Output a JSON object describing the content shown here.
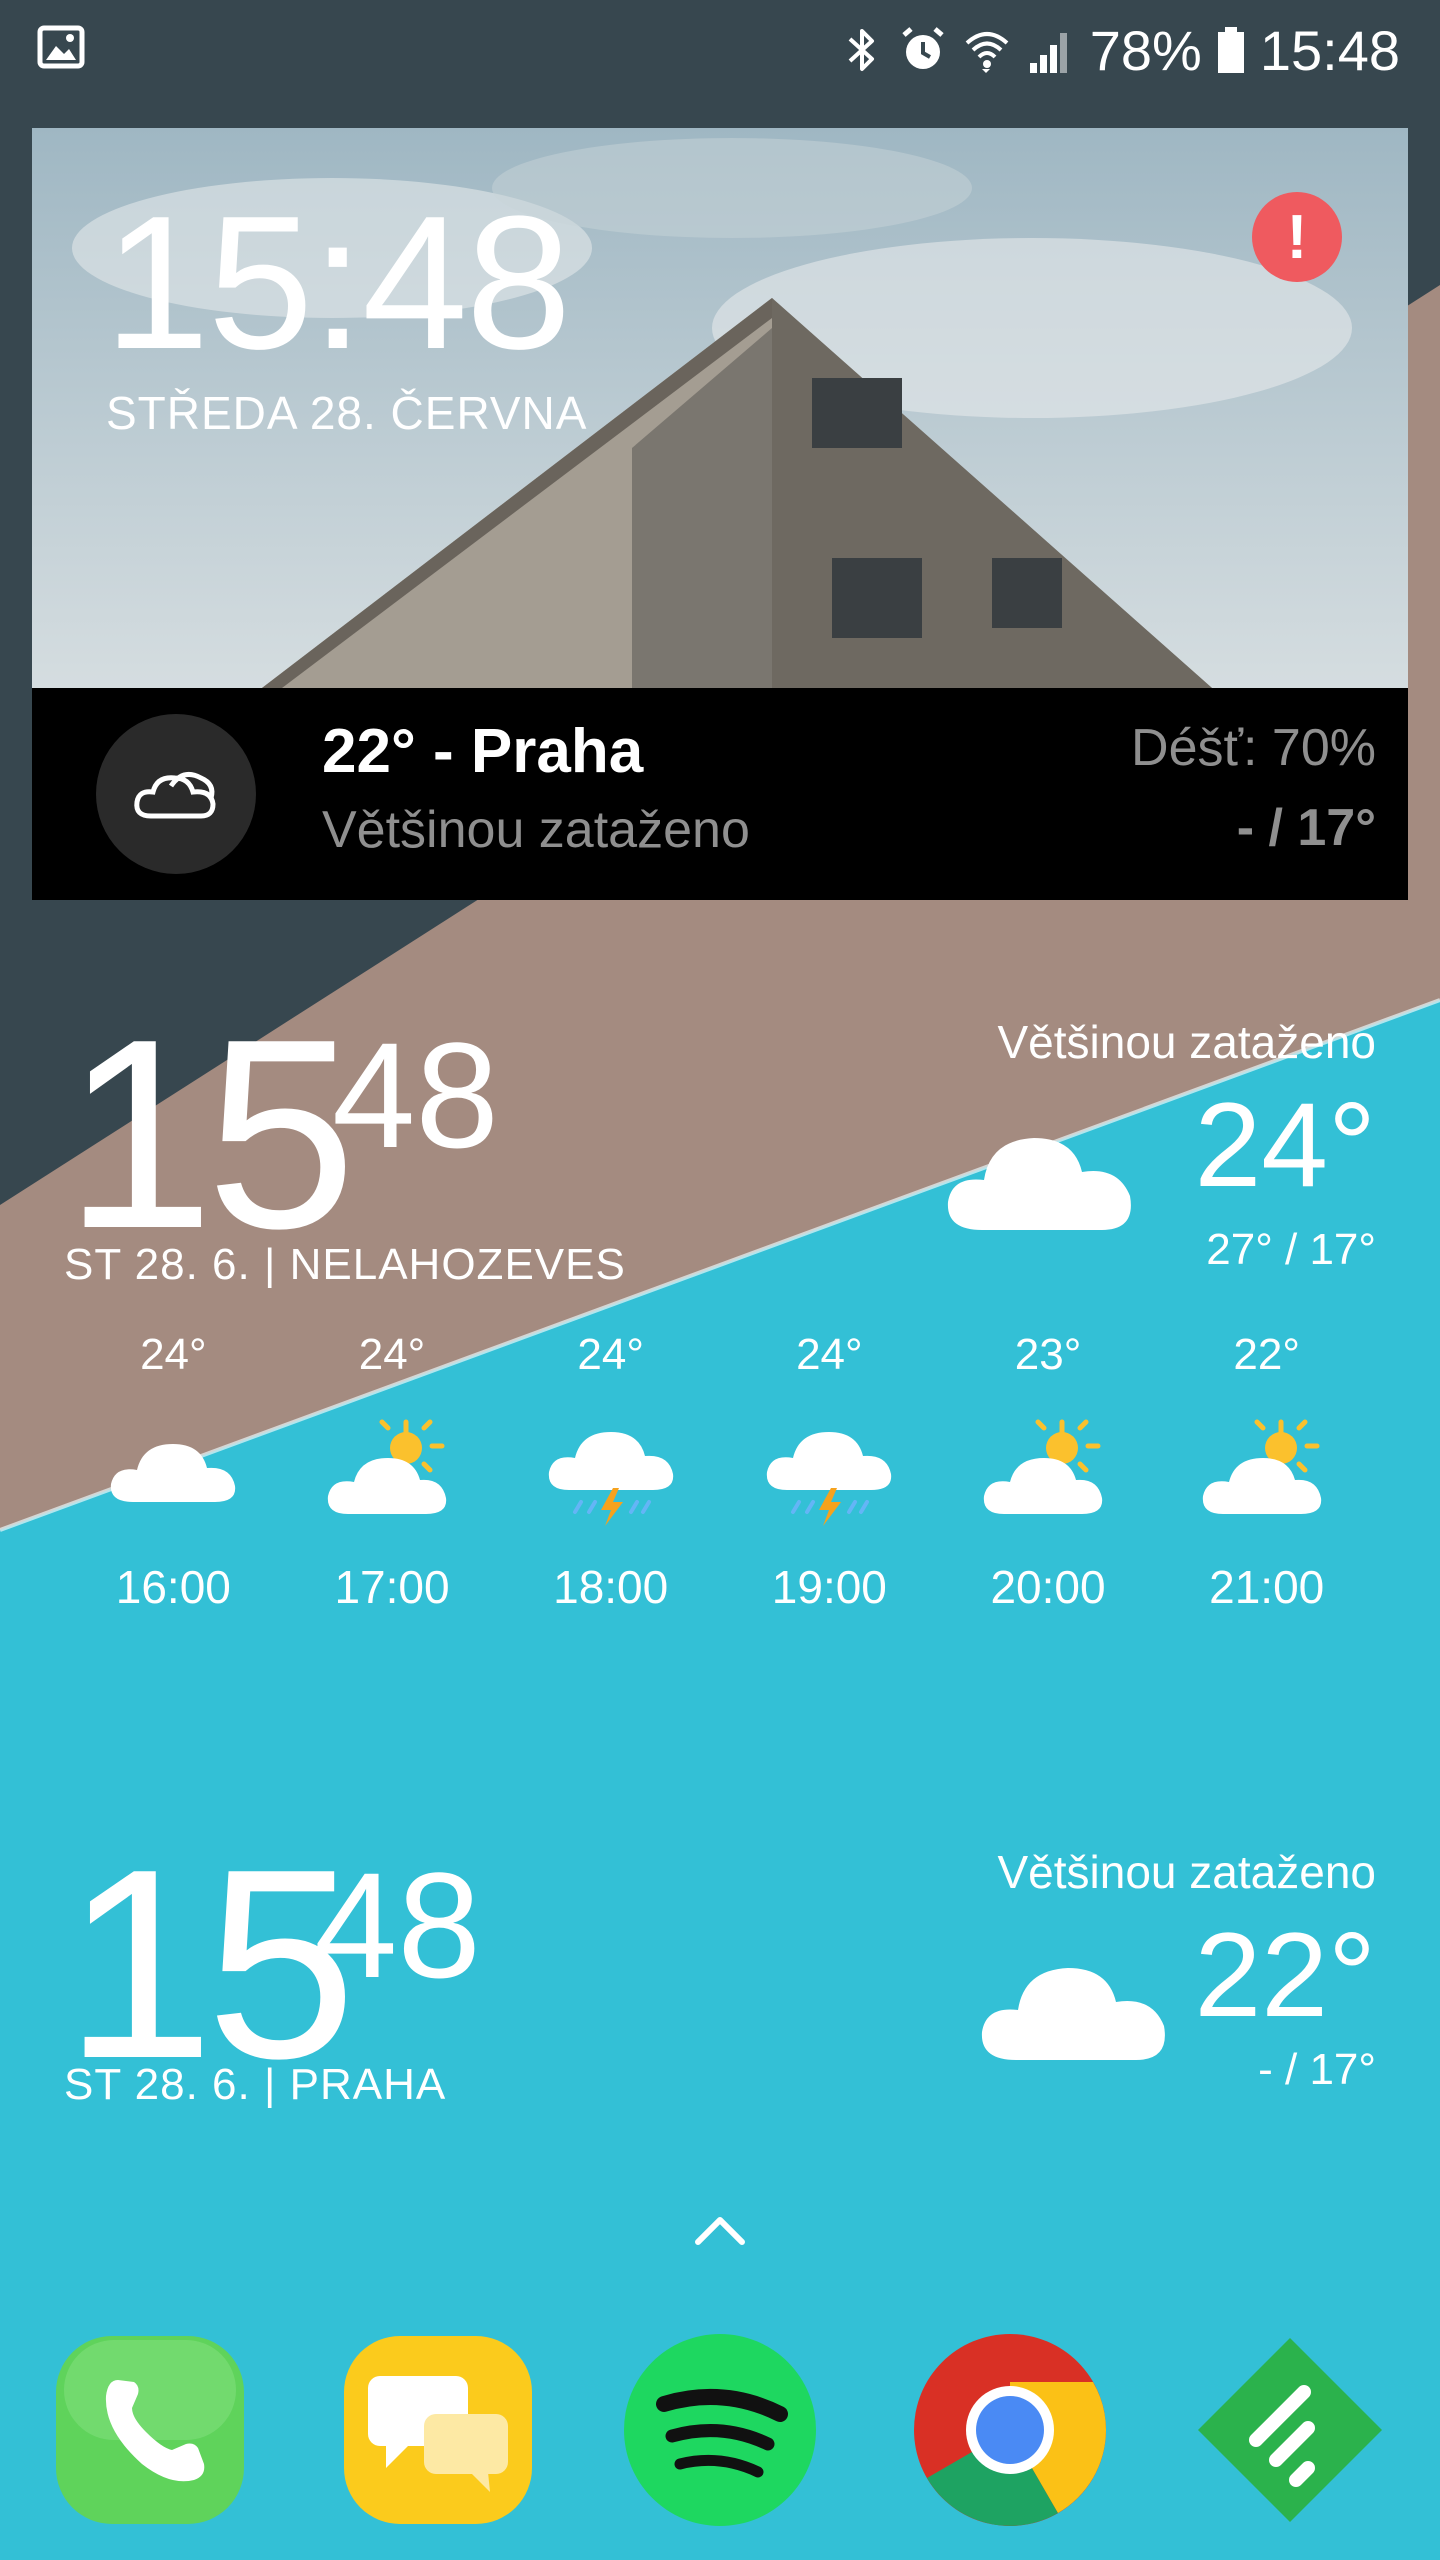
{
  "status_bar": {
    "battery": "78%",
    "time": "15:48",
    "icons": [
      "gallery-notification-icon",
      "bluetooth-icon",
      "alarm-icon",
      "wifi-icon",
      "signal-icon",
      "battery-icon"
    ]
  },
  "widget_photo": {
    "time": "15:48",
    "date": "STŘEDA 28. ČERVNA",
    "alert": "!",
    "temp_city": "22° - Praha",
    "condition": "Většinou zataženo",
    "rain": "Déšť: 70%",
    "hilo": "- / 17°"
  },
  "clock_nelahozeves": {
    "hour": "15",
    "minute": "48",
    "label": "ST 28. 6. | NELAHOZEVES",
    "condition": "Většinou zataženo",
    "temp": "24°",
    "hilo": "27° / 17°"
  },
  "hourly": [
    {
      "temp": "24°",
      "time": "16:00",
      "icon": "cloud"
    },
    {
      "temp": "24°",
      "time": "17:00",
      "icon": "sun-cloud"
    },
    {
      "temp": "24°",
      "time": "18:00",
      "icon": "storm"
    },
    {
      "temp": "24°",
      "time": "19:00",
      "icon": "storm"
    },
    {
      "temp": "23°",
      "time": "20:00",
      "icon": "sun-cloud"
    },
    {
      "temp": "22°",
      "time": "21:00",
      "icon": "sun-cloud"
    }
  ],
  "clock_praha": {
    "hour": "15",
    "minute": "48",
    "label": "ST 28. 6. | PRAHA",
    "condition": "Většinou zataženo",
    "temp": "22°",
    "hilo": "- / 17°"
  },
  "dock": [
    "phone-app",
    "messages-app",
    "spotify-app",
    "chrome-app",
    "feedly-app"
  ],
  "colors": {
    "dark": "#37474f",
    "tan": "#a48b80",
    "cyan": "#33c0d6",
    "alert": "#ef5a5f"
  }
}
